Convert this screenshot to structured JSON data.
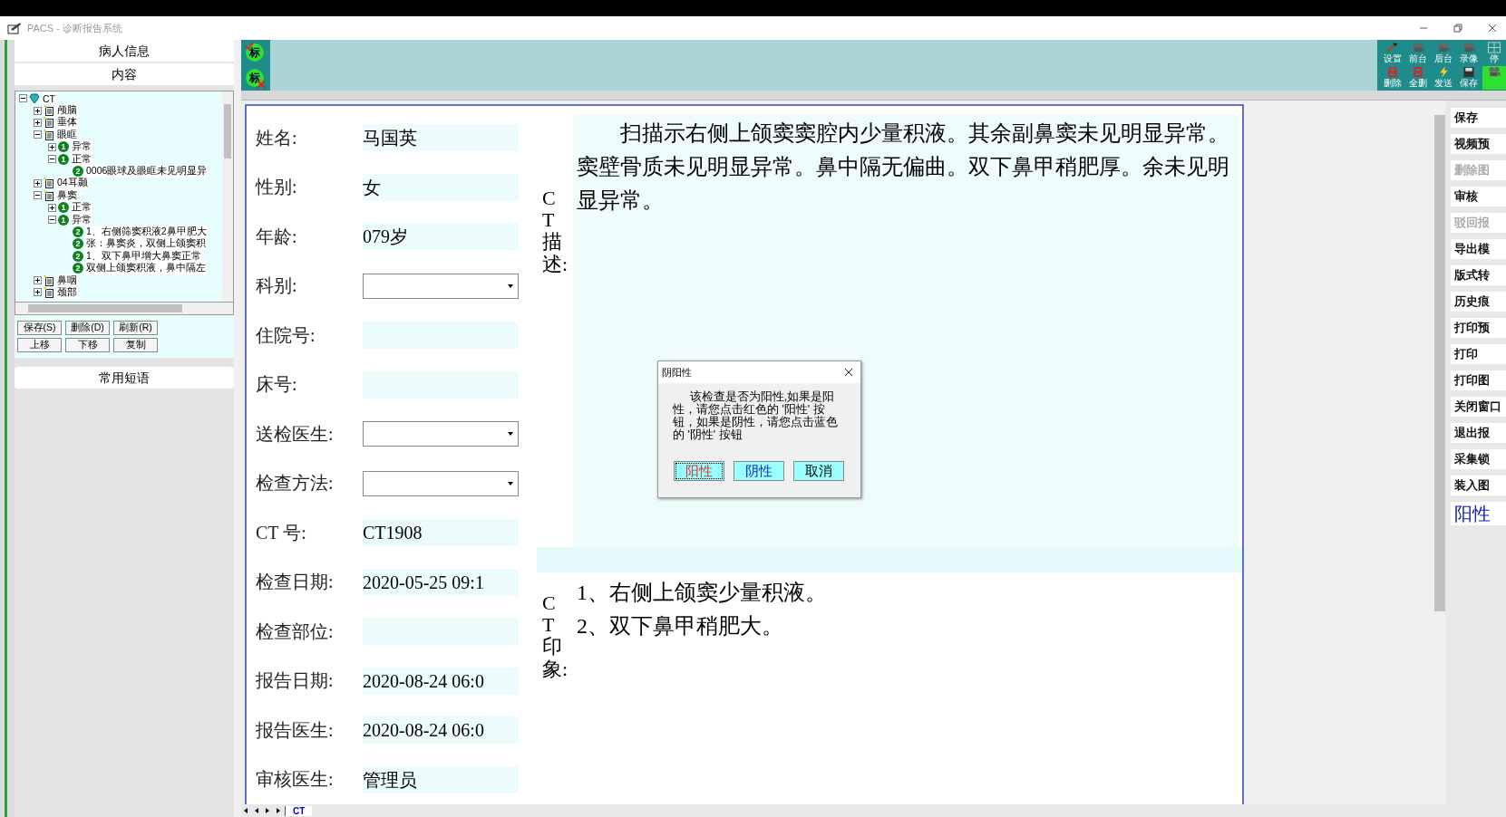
{
  "window": {
    "title": "PACS - 诊断报告系统"
  },
  "left_panel": {
    "header": "病人信息",
    "subheader": "内容",
    "tree": [
      {
        "label": "CT",
        "kind": "root",
        "expanded": true,
        "children": [
          {
            "label": "颅脑",
            "kind": "folder",
            "expanded": false
          },
          {
            "label": "垂体",
            "kind": "folder",
            "expanded": false
          },
          {
            "label": "眼眶",
            "kind": "folder",
            "expanded": true,
            "children": [
              {
                "label": "异常",
                "kind": "group",
                "badge": "1",
                "expanded": false
              },
              {
                "label": "正常",
                "kind": "group",
                "badge": "1",
                "expanded": true,
                "children": [
                  {
                    "label": "0006眼球及眼眶未见明显异",
                    "kind": "finding",
                    "badge": "2"
                  }
                ]
              }
            ]
          },
          {
            "label": "04耳颞",
            "kind": "folder",
            "expanded": false
          },
          {
            "label": "鼻窦",
            "kind": "folder",
            "expanded": true,
            "children": [
              {
                "label": "正常",
                "kind": "group",
                "badge": "1",
                "expanded": false
              },
              {
                "label": "异常",
                "kind": "group",
                "badge": "1",
                "expanded": true,
                "children": [
                  {
                    "label": "1、右侧筛窦积液2鼻甲肥大",
                    "kind": "finding",
                    "badge": "2"
                  },
                  {
                    "label": "张：鼻窦炎，双侧上颌窦积",
                    "kind": "finding",
                    "badge": "2"
                  },
                  {
                    "label": "1、双下鼻甲增大鼻窦正常",
                    "kind": "finding",
                    "badge": "2"
                  },
                  {
                    "label": "双侧上颌窦积液，鼻中隔左",
                    "kind": "finding",
                    "badge": "2"
                  }
                ]
              }
            ]
          },
          {
            "label": "鼻咽",
            "kind": "folder",
            "expanded": false
          },
          {
            "label": "颈部",
            "kind": "folder",
            "expanded": false
          }
        ]
      }
    ],
    "buttons": [
      "保存(S)",
      "删除(D)",
      "刷新(R)",
      "上移",
      "下移",
      "复制"
    ],
    "phrases_header": "常用短语"
  },
  "marker_buttons": [
    {
      "label": "标",
      "kind": "check"
    },
    {
      "label": "标",
      "kind": "cross"
    }
  ],
  "toolbar": [
    {
      "label": "设置",
      "kind": "tools"
    },
    {
      "label": "前台",
      "kind": "camera"
    },
    {
      "label": "后台",
      "kind": "camera"
    },
    {
      "label": "录像",
      "kind": "camera"
    },
    {
      "label": "停",
      "kind": "grid"
    },
    {
      "label": "删除",
      "kind": "delete"
    },
    {
      "label": "全删",
      "kind": "delete"
    },
    {
      "label": "发送",
      "kind": "bolt"
    },
    {
      "label": "保存",
      "kind": "disk"
    },
    {
      "kind": "camera-active"
    }
  ],
  "form": {
    "fields": [
      {
        "label": "姓名:",
        "kind": "text",
        "value": "马国英"
      },
      {
        "label": "性别:",
        "kind": "text",
        "value": "女"
      },
      {
        "label": "年龄:",
        "kind": "text",
        "value": "079岁"
      },
      {
        "label": "科别:",
        "kind": "select"
      },
      {
        "label": "住院号:",
        "kind": "text"
      },
      {
        "label": "床号:",
        "kind": "text"
      },
      {
        "label": "送检医生:",
        "kind": "select"
      },
      {
        "label": "检查方法:",
        "kind": "select"
      },
      {
        "label": "CT 号:",
        "kind": "text",
        "value": "CT1908"
      },
      {
        "label": "检查日期:",
        "kind": "text",
        "value": "2020-05-25 09:1"
      },
      {
        "label": "检查部位:",
        "kind": "text"
      },
      {
        "label": "报告日期:",
        "kind": "text",
        "value": "2020-08-24  06:0"
      },
      {
        "label": "报告医生:",
        "kind": "text",
        "value": "2020-08-24  06:0"
      },
      {
        "label": "审核医生:",
        "kind": "text",
        "value": "管理员"
      }
    ],
    "description": {
      "label": "CT描述:",
      "text": "扫描示右侧上颌窦窦腔内少量积液。其余副鼻窦未见明显异常。窦壁骨质未见明显异常。鼻中隔无偏曲。双下鼻甲稍肥厚。余未见明显异常。"
    },
    "impression": {
      "label": "CT印象:",
      "lines": [
        "1、右侧上颌窦少量积液。",
        "2、双下鼻甲稍肥大。"
      ]
    }
  },
  "sidebar": [
    {
      "label": "保存",
      "disabled": false,
      "kind": "button"
    },
    {
      "label": "视频预",
      "disabled": false,
      "kind": "button"
    },
    {
      "label": "删除图",
      "disabled": true,
      "kind": "button"
    },
    {
      "label": "审核",
      "disabled": false,
      "kind": "button"
    },
    {
      "label": "驳回报",
      "disabled": true,
      "kind": "button"
    },
    {
      "label": "导出模",
      "disabled": false,
      "kind": "button"
    },
    {
      "label": "版式转",
      "disabled": false,
      "kind": "button"
    },
    {
      "label": "历史痕",
      "disabled": false,
      "kind": "button"
    },
    {
      "label": "打印预",
      "disabled": false,
      "kind": "button"
    },
    {
      "label": "打印",
      "disabled": false,
      "kind": "button"
    },
    {
      "label": "打印图",
      "disabled": false,
      "kind": "button"
    },
    {
      "label": "关闭窗口",
      "disabled": false,
      "kind": "button"
    },
    {
      "label": "退出报",
      "disabled": false,
      "kind": "button"
    },
    {
      "label": "采集锁",
      "disabled": false,
      "kind": "button"
    },
    {
      "label": "装入图",
      "disabled": false,
      "kind": "button"
    },
    {
      "label": "阳性",
      "kind": "status"
    }
  ],
  "sheet_tabs": [
    {
      "label": "CT",
      "selected": true
    }
  ],
  "dialog": {
    "title": "阴阳性",
    "message": "该检查是否为阳性,如果是阳性，请您点击红色的 '阳性' 按钮，如果是阴性，请您点击蓝色的 '阴性' 按钮",
    "buttons": [
      {
        "label": "阳性",
        "kind": "positive",
        "selected": true
      },
      {
        "label": "阴性",
        "kind": "negative",
        "selected": false
      },
      {
        "label": "取消",
        "kind": "cancel",
        "selected": false
      }
    ]
  }
}
